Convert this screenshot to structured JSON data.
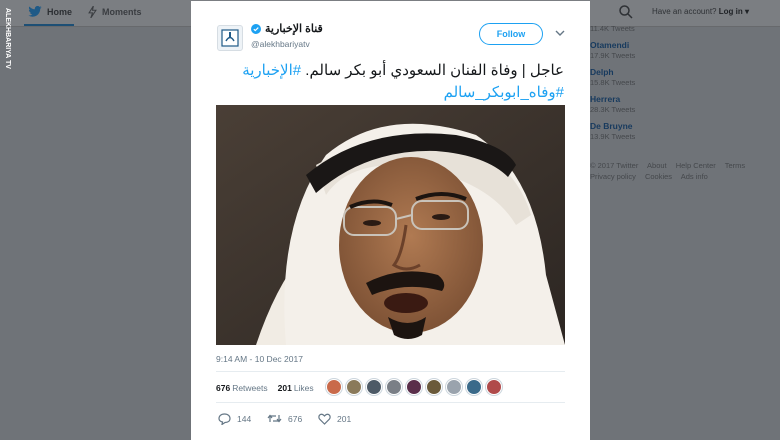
{
  "watermark": "ALEKHBARIYA TV",
  "topbar": {
    "home_label": "Home",
    "moments_label": "Moments",
    "account_prompt": "Have an account?",
    "login_label": "Log in",
    "login_caret": "▾"
  },
  "sidebar": {
    "partial_count": "11.4K Tweets",
    "users": [
      {
        "name": "Otamendi",
        "count": "17.9K Tweets"
      },
      {
        "name": "Delph",
        "count": "15.8K Tweets"
      },
      {
        "name": "Herrera",
        "count": "28.3K Tweets"
      },
      {
        "name": "De Bruyne",
        "count": "13.9K Tweets"
      }
    ],
    "footer_row1": [
      "© 2017 Twitter",
      "About",
      "Help Center",
      "Terms"
    ],
    "footer_row2": [
      "Privacy policy",
      "Cookies",
      "Ads info"
    ]
  },
  "tweet": {
    "display_name": "قناة الإخبارية",
    "handle": "@alekhbariyatv",
    "follow_label": "Follow",
    "text_line1": "عاجل | وفاة الفنان السعودي أبو بكر سالم.",
    "hashtag1": "#الإخبارية",
    "hashtag2": "#وفاه_ابوبكر_سالم",
    "timestamp": "9:14 AM - 10 Dec 2017",
    "retweets_count": "676",
    "retweets_label": "Retweets",
    "likes_count": "201",
    "likes_label": "Likes",
    "reply_count": "144",
    "retweet_action_count": "676",
    "like_action_count": "201"
  },
  "colors": {
    "accent": "#1da1f2",
    "verified": "#1da1f2",
    "overlay": "#6f7378"
  }
}
